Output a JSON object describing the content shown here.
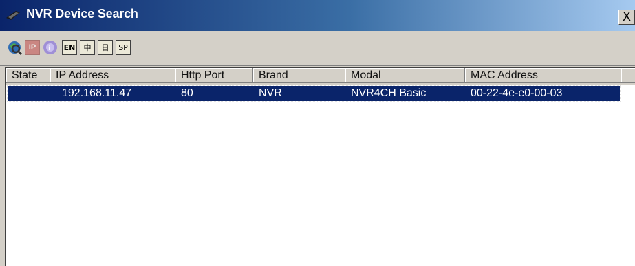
{
  "window": {
    "title": "NVR Device Search",
    "close_glyph": "X"
  },
  "toolbar": {
    "buttons": [
      {
        "name": "search-icon"
      },
      {
        "name": "ip-icon",
        "label": "IP"
      },
      {
        "name": "info-icon"
      },
      {
        "name": "english-icon",
        "label": "EN"
      },
      {
        "name": "chinese-icon",
        "label": "中"
      },
      {
        "name": "japanese-icon",
        "label": "日"
      },
      {
        "name": "sp-icon",
        "label": "SP"
      }
    ]
  },
  "table": {
    "columns": [
      "State",
      "IP Address",
      "Http Port",
      "Brand",
      "Modal",
      "MAC Address"
    ],
    "rows": [
      {
        "state": "",
        "ip": "192.168.11.47",
        "port": "80",
        "brand": "NVR",
        "modal": "NVR4CH Basic",
        "mac": "00-22-4e-e0-00-03"
      }
    ]
  },
  "colors": {
    "title_start": "#0a246a",
    "title_end": "#a6caf0",
    "selection": "#0a246a",
    "face": "#d4d0c8"
  }
}
